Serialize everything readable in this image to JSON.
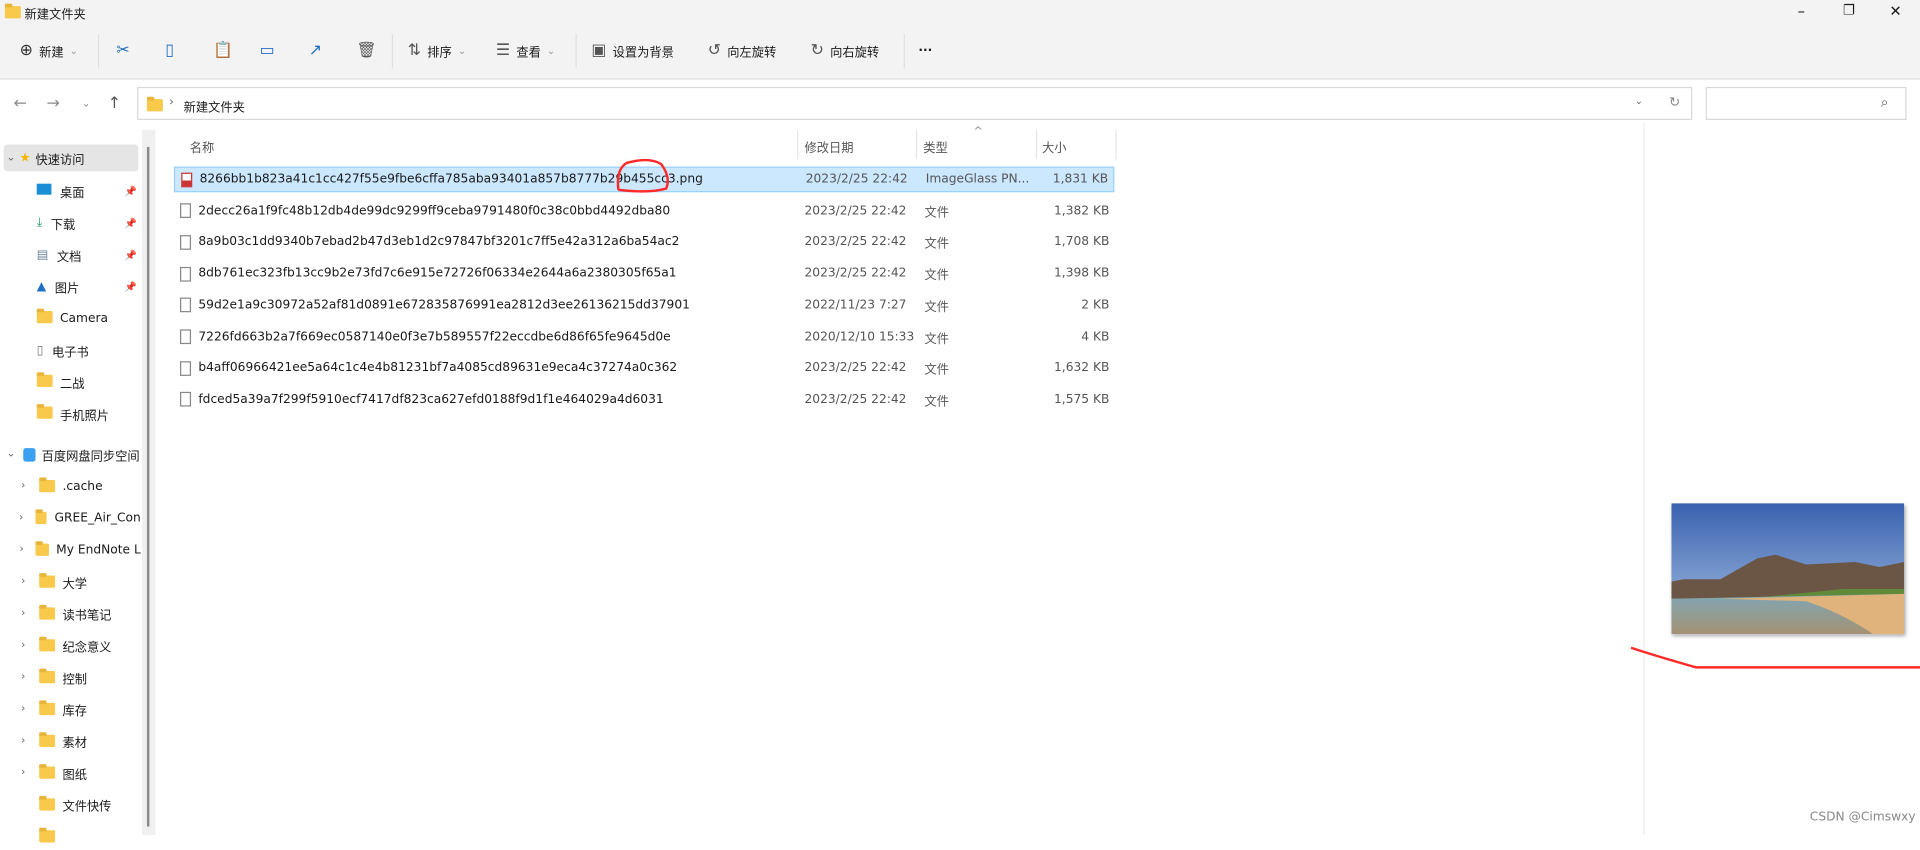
{
  "window": {
    "title": "新建文件夹",
    "controls": [
      "minimize",
      "maximize",
      "close"
    ]
  },
  "toolbar": {
    "new_label": "新建",
    "sort_label": "排序",
    "view_label": "查看",
    "set_bg_label": "设置为背景",
    "rotate_left_label": "向左旋转",
    "rotate_right_label": "向右旋转",
    "more_label": "···",
    "icons": [
      "cut-icon",
      "copy-icon",
      "paste-icon",
      "rename-icon",
      "share-icon",
      "delete-icon"
    ]
  },
  "address": {
    "path": "新建文件夹",
    "search_placeholder": ""
  },
  "sidebar": {
    "quick_access": {
      "label": "快速访问",
      "items": [
        {
          "label": "桌面",
          "icon": "desktop-icon",
          "pinned": true
        },
        {
          "label": "下载",
          "icon": "download-icon",
          "pinned": true
        },
        {
          "label": "文档",
          "icon": "document-icon",
          "pinned": true
        },
        {
          "label": "图片",
          "icon": "pictures-icon",
          "pinned": true
        },
        {
          "label": "Camera",
          "icon": "folder-icon"
        },
        {
          "label": "电子书",
          "icon": "file-icon"
        },
        {
          "label": "二战",
          "icon": "folder-icon"
        },
        {
          "label": "手机照片",
          "icon": "folder-icon"
        }
      ]
    },
    "baidu": {
      "label": "百度网盘同步空间",
      "items": [
        {
          "label": ".cache",
          "expandable": true
        },
        {
          "label": "GREE_Air_Con",
          "expandable": true
        },
        {
          "label": "My EndNote L",
          "expandable": true
        },
        {
          "label": "大学",
          "expandable": true
        },
        {
          "label": "读书笔记",
          "expandable": true
        },
        {
          "label": "纪念意义",
          "expandable": true
        },
        {
          "label": "控制",
          "expandable": true
        },
        {
          "label": "库存",
          "expandable": true
        },
        {
          "label": "素材",
          "expandable": true
        },
        {
          "label": "图纸",
          "expandable": true
        },
        {
          "label": "文件快传",
          "expandable": false
        }
      ]
    }
  },
  "columns": {
    "name": "名称",
    "date": "修改日期",
    "type": "类型",
    "size": "大小",
    "sort_indicator": "^"
  },
  "files": [
    {
      "name": "8266bb1b823a41c1cc427f55e9fbe6cffa785aba93401a857b8777b29b455cc3.png",
      "date": "2023/2/25 22:42",
      "type": "ImageGlass PN...",
      "size": "1,831 KB",
      "selected": true,
      "icon": "png-icon"
    },
    {
      "name": "2decc26a1f9fc48b12db4de99dc9299ff9ceba9791480f0c38c0bbd4492dba80",
      "date": "2023/2/25 22:42",
      "type": "文件",
      "size": "1,382 KB"
    },
    {
      "name": "8a9b03c1dd9340b7ebad2b47d3eb1d2c97847bf3201c7ff5e42a312a6ba54ac2",
      "date": "2023/2/25 22:42",
      "type": "文件",
      "size": "1,708 KB"
    },
    {
      "name": "8db761ec323fb13cc9b2e73fd7c6e915e72726f06334e2644a6a2380305f65a1",
      "date": "2023/2/25 22:42",
      "type": "文件",
      "size": "1,398 KB"
    },
    {
      "name": "59d2e1a9c30972a52af81d0891e672835876991ea2812d3ee26136215dd37901",
      "date": "2022/11/23 7:27",
      "type": "文件",
      "size": "2 KB"
    },
    {
      "name": "7226fd663b2a7f669ec0587140e0f3e7b589557f22eccdbe6d86f65fe9645d0e",
      "date": "2020/12/10 15:33",
      "type": "文件",
      "size": "4 KB"
    },
    {
      "name": "b4aff06966421ee5a64c1c4e4b81231bf7a4085cd89631e9eca4c37274a0c362",
      "date": "2023/2/25 22:42",
      "type": "文件",
      "size": "1,632 KB"
    },
    {
      "name": "fdced5a39a7f299f5910ecf7417df823ca627efd0188f9d1f1e464029a4d6031",
      "date": "2023/2/25 22:42",
      "type": "文件",
      "size": "1,575 KB"
    }
  ],
  "preview": {
    "kind": "beach landscape thumbnail"
  },
  "watermark": "CSDN @Cimswxy",
  "colors": {
    "selection": "#cce8ff",
    "selection_border": "#99d1ff",
    "accent": "#1f6fc5",
    "annotation": "#ff2a2a"
  }
}
